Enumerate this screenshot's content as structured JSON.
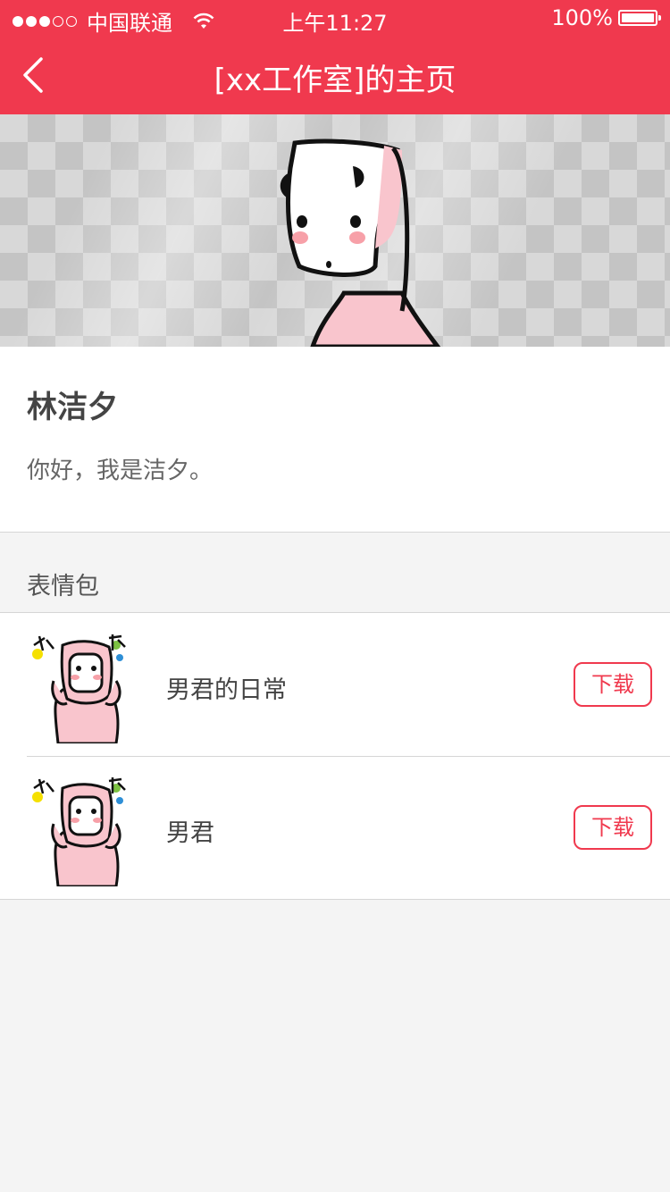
{
  "status_bar": {
    "carrier": "中国联通",
    "time": "上午11:27",
    "battery": "100%"
  },
  "nav": {
    "title": "[xx工作室]的主页",
    "back_icon": "chevron-left-icon"
  },
  "profile": {
    "name": "林洁夕",
    "bio": "你好，我是洁夕。"
  },
  "section": {
    "title": "表情包"
  },
  "packs": [
    {
      "title": "男君的日常",
      "button": "下载"
    },
    {
      "title": "男君",
      "button": "下载"
    }
  ],
  "colors": {
    "accent": "#f0394e",
    "background": "#f4f4f4",
    "character_pink": "#f9c5cd"
  }
}
